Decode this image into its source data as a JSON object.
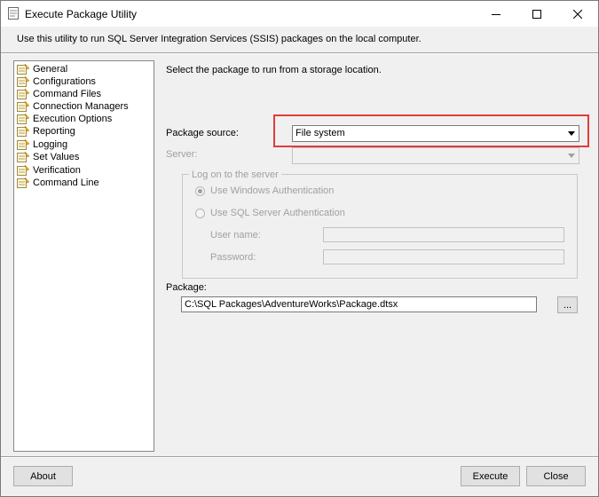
{
  "window": {
    "title": "Execute Package Utility"
  },
  "description": "Use this utility to run SQL Server Integration Services (SSIS) packages on the local computer.",
  "nav": {
    "items": [
      {
        "label": "General"
      },
      {
        "label": "Configurations"
      },
      {
        "label": "Command Files"
      },
      {
        "label": "Connection Managers"
      },
      {
        "label": "Execution Options"
      },
      {
        "label": "Reporting"
      },
      {
        "label": "Logging"
      },
      {
        "label": "Set Values"
      },
      {
        "label": "Verification"
      },
      {
        "label": "Command Line"
      }
    ]
  },
  "main": {
    "instruction": "Select the package to run from a storage location.",
    "package_source_label": "Package source:",
    "package_source_value": "File system",
    "server_label": "Server:",
    "server_value": "",
    "logon_group_title": "Log on to the server",
    "windows_auth_label": "Use Windows Authentication",
    "sql_auth_label": "Use SQL Server Authentication",
    "username_label": "User name:",
    "username_value": "",
    "password_label": "Password:",
    "password_value": "",
    "package_label": "Package:",
    "package_path": "C:\\SQL Packages\\AdventureWorks\\Package.dtsx",
    "browse_label": "..."
  },
  "footer": {
    "about_label": "About",
    "execute_label": "Execute",
    "close_label": "Close"
  },
  "colors": {
    "highlight": "#e23b3b",
    "window_bg": "#f0f0f0",
    "disabled_text": "#a0a0a0"
  },
  "icons": {
    "app": "package-utility-icon",
    "nav": "page-icon",
    "minimize": "minimize-icon",
    "maximize": "maximize-icon",
    "close": "close-icon",
    "dropdown": "chevron-down-icon"
  }
}
